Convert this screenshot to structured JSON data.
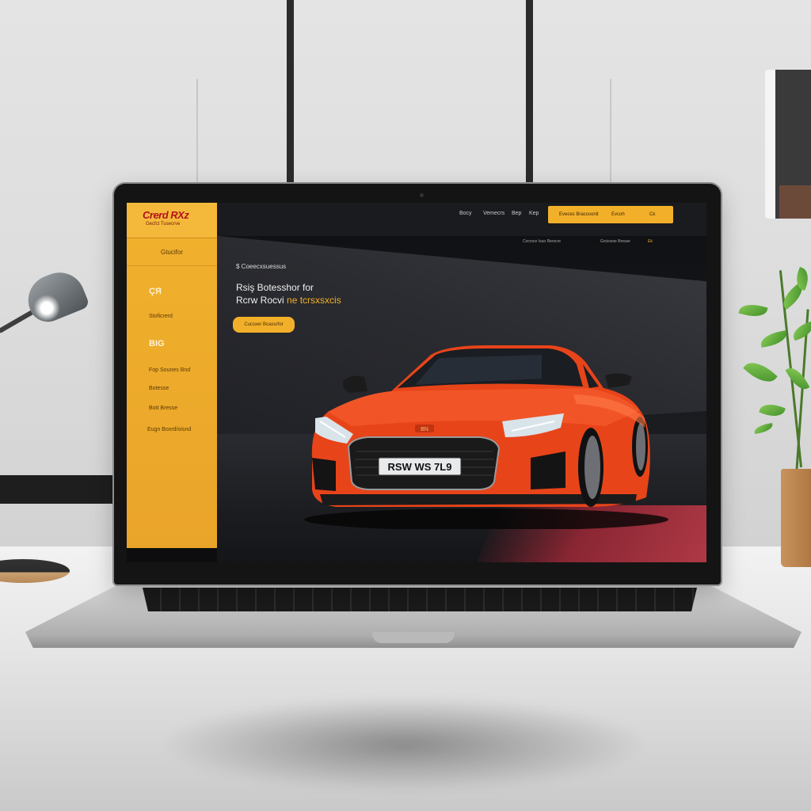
{
  "site": {
    "logo": "Crerd RXz",
    "logo_tagline": "Gecfct Tusecrve",
    "sidebar": {
      "top_item": "Gtucifor",
      "items": [
        {
          "icon_text": "ÇЯ",
          "label": "Stoficrerd"
        },
        {
          "icon_text": "BIG",
          "label": "Fop Sounes Bnd"
        },
        {
          "label": "Botesse"
        },
        {
          "label": "Bott Bresse"
        },
        {
          "label": "Eugn Boxrd/oisnd"
        }
      ]
    },
    "topbar": {
      "links": [
        "Bocy",
        "Vemecrs",
        "Bep",
        "Kep"
      ],
      "cta_label": "Eveces Bracosonit",
      "cta_right": "Evcoh",
      "cta_badge": "Ck"
    },
    "subnav": [
      "Cocrsce Isuo Rerscre",
      "Gociosse Bresse",
      "Ek"
    ],
    "hero": {
      "label": "$ Coeecxsuessus",
      "title_line1": "Rsiş Botesshor for",
      "title_line2_plain": "Rcrw Rocvi",
      "title_line2_highlight": "ne tcrsxsxcis",
      "button_label": "Cucsxer Boassrfor"
    },
    "car": {
      "plate": "RSW WS 7L9",
      "badge": "BN",
      "body_color": "#e8441a"
    },
    "colors": {
      "accent": "#f2b02a",
      "sidebar": "#e9a42a",
      "topbar": "#1a1b1f"
    }
  }
}
